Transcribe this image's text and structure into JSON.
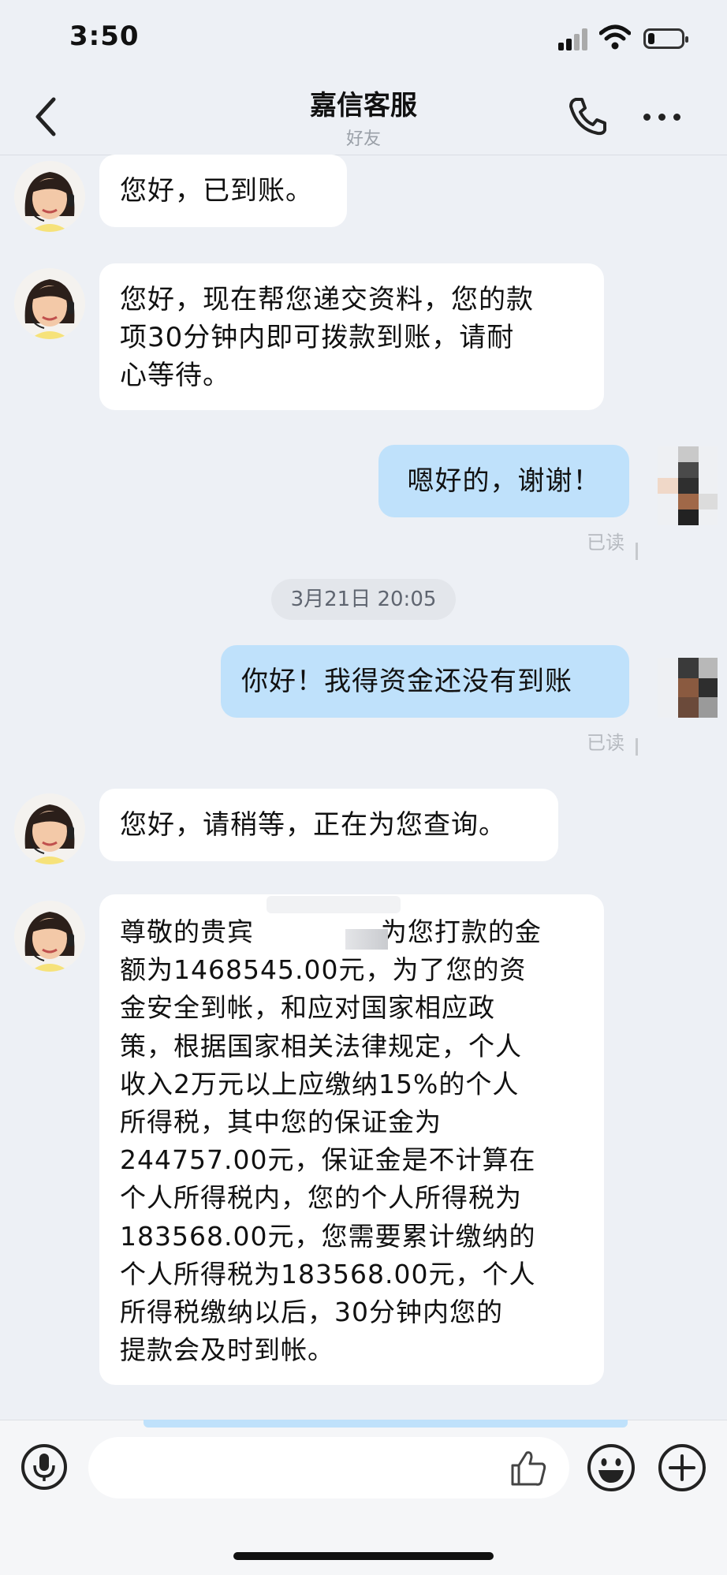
{
  "status_bar": {
    "time": "3:50"
  },
  "header": {
    "title": "嘉信客服",
    "subtitle": "好友"
  },
  "messages": [
    {
      "side": "in",
      "text": "您好，已到账。"
    },
    {
      "side": "in",
      "text": "您好，现在帮您递交资料，您的款\n项30分钟内即可拨款到账，请耐\n心等待。"
    },
    {
      "side": "out",
      "text": "嗯好的，谢谢！",
      "status": "已读"
    },
    {
      "side": "out",
      "text": "你好！我得资金还没有到账",
      "status": "已读"
    },
    {
      "side": "in",
      "text": "您好，请稍等，正在为您查询。"
    },
    {
      "side": "in",
      "text": "尊敬的贵宾              为您打款的金\n额为1468545.00元，为了您的资\n金安全到帐，和应对国家相应政\n策，根据国家相关法律规定，个人\n收入2万元以上应缴纳15%的个人\n所得税，其中您的保证金为\n244757.00元，保证金是不计算在\n个人所得税内，您的个人所得税为\n183568.00元，您需要累计缴纳的\n个人所得税为183568.00元，个人\n所得税缴纳以后，30分钟内您的\n提款会及时到帐。"
    }
  ],
  "timestamp": "3月21日 20:05",
  "colors": {
    "background": "#edf0f5",
    "outgoing_bubble": "#bfe1fb",
    "incoming_bubble": "#ffffff"
  },
  "icons": [
    "back-icon",
    "phone-icon",
    "more-icon",
    "mic-icon",
    "thumbs-up-icon",
    "emoji-icon",
    "plus-icon"
  ]
}
